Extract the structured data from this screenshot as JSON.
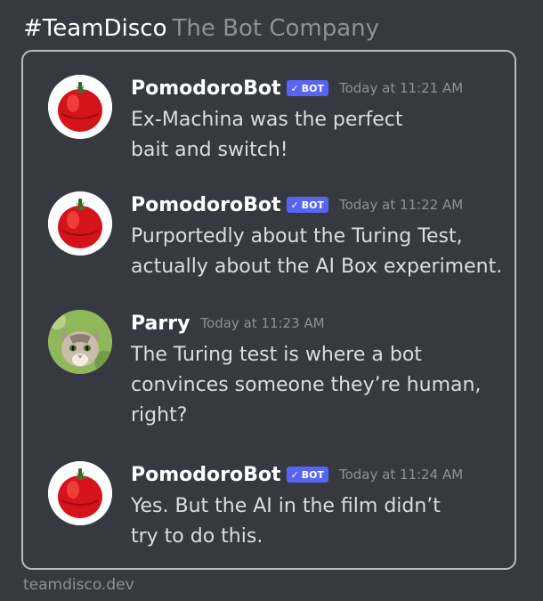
{
  "header": {
    "team": "#TeamDisco",
    "company": "The Bot Company"
  },
  "messages": [
    {
      "username": "PomodoroBot",
      "bot_label": "BOT",
      "timestamp": "Today at 11:21 AM",
      "text": "Ex-Machina was the perfect\nbait and switch!",
      "avatar_icon": "tomato-timer-icon"
    },
    {
      "username": "PomodoroBot",
      "bot_label": "BOT",
      "timestamp": "Today at 11:22 AM",
      "text": "Purportedly about the Turing Test,\nactually about the AI Box experiment.",
      "avatar_icon": "tomato-timer-icon"
    },
    {
      "username": "Parry",
      "timestamp": "Today at 11:23 AM",
      "text": "The Turing test is where a bot\nconvinces someone they’re human,\nright?",
      "avatar_icon": "cat-icon"
    },
    {
      "username": "PomodoroBot",
      "bot_label": "BOT",
      "timestamp": "Today at 11:24 AM",
      "text": "Yes.  But the AI in the film didn’t\ntry to do this.",
      "avatar_icon": "tomato-timer-icon"
    }
  ],
  "footer": {
    "site": "teamdisco.dev"
  },
  "colors": {
    "background": "#36393f",
    "bot_tag": "#5865f2",
    "timestamp": "#8e9297",
    "username": "#ffffff",
    "message_text": "#dcddde"
  }
}
